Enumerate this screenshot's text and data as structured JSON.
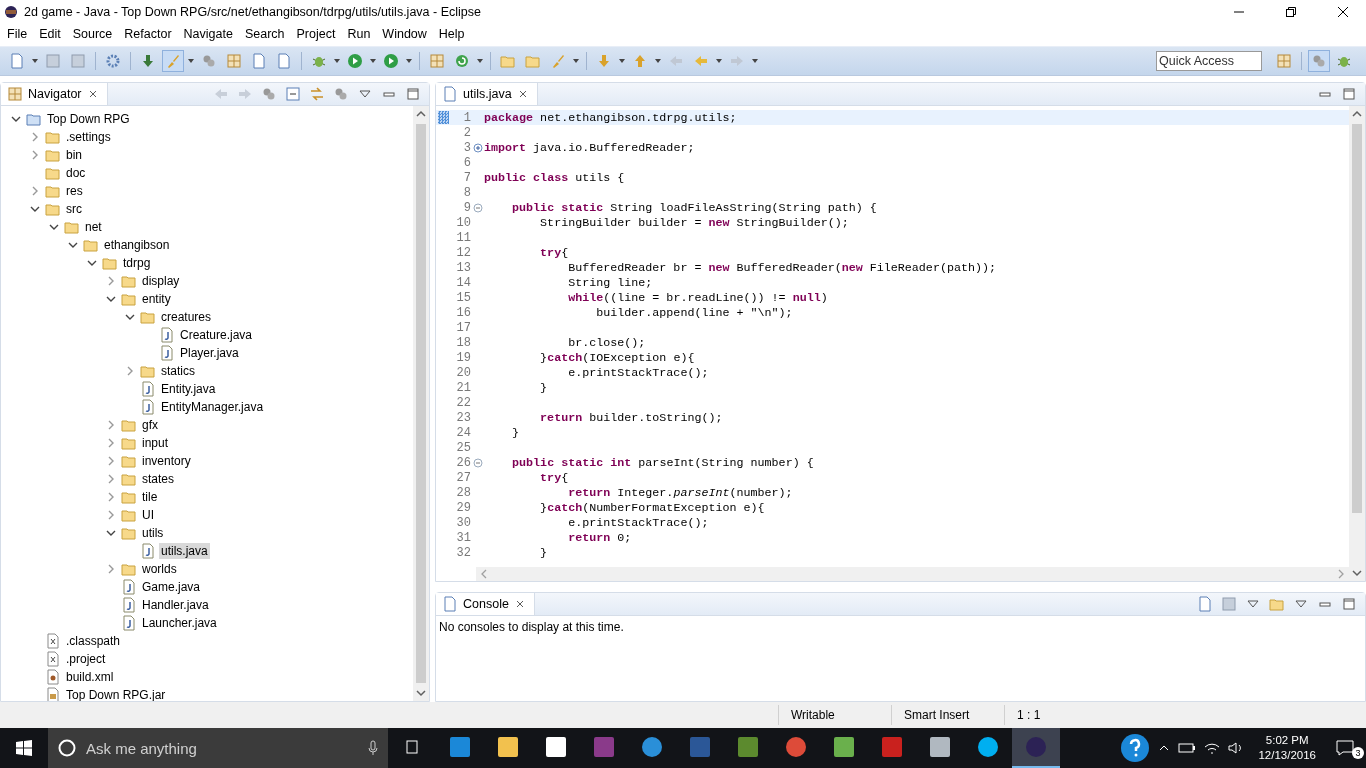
{
  "window": {
    "title": "2d game - Java - Top Down RPG/src/net/ethangibson/tdrpg/utils/utils.java - Eclipse"
  },
  "menu": [
    "File",
    "Edit",
    "Source",
    "Refactor",
    "Navigate",
    "Search",
    "Project",
    "Run",
    "Window",
    "Help"
  ],
  "quick_access": {
    "placeholder": "Quick Access"
  },
  "navigator": {
    "title": "Navigator",
    "tree": [
      {
        "label": "Top Down RPG",
        "kind": "project",
        "expanded": true,
        "selected": false,
        "children": [
          {
            "label": ".settings",
            "kind": "folder",
            "expanded": false,
            "selected": false
          },
          {
            "label": "bin",
            "kind": "folder",
            "expanded": false,
            "selected": false
          },
          {
            "label": "doc",
            "kind": "folder",
            "selected": false
          },
          {
            "label": "res",
            "kind": "folder",
            "expanded": false,
            "selected": false
          },
          {
            "label": "src",
            "kind": "folder",
            "expanded": true,
            "selected": false,
            "children": [
              {
                "label": "net",
                "kind": "folder",
                "expanded": true,
                "selected": false,
                "children": [
                  {
                    "label": "ethangibson",
                    "kind": "folder",
                    "expanded": true,
                    "selected": false,
                    "children": [
                      {
                        "label": "tdrpg",
                        "kind": "folder",
                        "expanded": true,
                        "selected": false,
                        "children": [
                          {
                            "label": "display",
                            "kind": "folder",
                            "expanded": false,
                            "selected": false
                          },
                          {
                            "label": "entity",
                            "kind": "folder",
                            "expanded": true,
                            "selected": false,
                            "children": [
                              {
                                "label": "creatures",
                                "kind": "folder",
                                "expanded": true,
                                "selected": false,
                                "children": [
                                  {
                                    "label": "Creature.java",
                                    "kind": "java",
                                    "selected": false
                                  },
                                  {
                                    "label": "Player.java",
                                    "kind": "java",
                                    "selected": false
                                  }
                                ]
                              },
                              {
                                "label": "statics",
                                "kind": "folder",
                                "expanded": false,
                                "selected": false
                              },
                              {
                                "label": "Entity.java",
                                "kind": "java",
                                "selected": false
                              },
                              {
                                "label": "EntityManager.java",
                                "kind": "java",
                                "selected": false
                              }
                            ]
                          },
                          {
                            "label": "gfx",
                            "kind": "folder",
                            "expanded": false,
                            "selected": false
                          },
                          {
                            "label": "input",
                            "kind": "folder",
                            "expanded": false,
                            "selected": false
                          },
                          {
                            "label": "inventory",
                            "kind": "folder",
                            "expanded": false,
                            "selected": false
                          },
                          {
                            "label": "states",
                            "kind": "folder",
                            "expanded": false,
                            "selected": false
                          },
                          {
                            "label": "tile",
                            "kind": "folder",
                            "expanded": false,
                            "selected": false
                          },
                          {
                            "label": "UI",
                            "kind": "folder",
                            "expanded": false,
                            "selected": false
                          },
                          {
                            "label": "utils",
                            "kind": "folder",
                            "expanded": true,
                            "selected": false,
                            "children": [
                              {
                                "label": "utils.java",
                                "kind": "java",
                                "selected": true
                              }
                            ]
                          },
                          {
                            "label": "worlds",
                            "kind": "folder",
                            "expanded": false,
                            "selected": false
                          },
                          {
                            "label": "Game.java",
                            "kind": "java",
                            "selected": false
                          },
                          {
                            "label": "Handler.java",
                            "kind": "java",
                            "selected": false
                          },
                          {
                            "label": "Launcher.java",
                            "kind": "java",
                            "selected": false
                          }
                        ]
                      }
                    ]
                  }
                ]
              }
            ]
          },
          {
            "label": ".classpath",
            "kind": "xml",
            "selected": false
          },
          {
            "label": ".project",
            "kind": "xml",
            "selected": false
          },
          {
            "label": "build.xml",
            "kind": "ant",
            "selected": false
          },
          {
            "label": "Top Down RPG.jar",
            "kind": "jar",
            "selected": false
          }
        ]
      }
    ]
  },
  "editor": {
    "tab": "utils.java",
    "lines": [
      {
        "number": "1",
        "text": "**package** net.ethangibson.tdrpg.utils;",
        "current": true
      },
      {
        "number": "2",
        "current": false
      },
      {
        "number": "3",
        "text": "**import** java.io.BufferedReader;",
        "folded": true,
        "current": false
      },
      {
        "number": "6",
        "current": false
      },
      {
        "number": "7",
        "text": "**public** **class** utils {",
        "current": false
      },
      {
        "number": "8",
        "current": false
      },
      {
        "number": "9",
        "text": "    **public** **static** String loadFileAsString(String path) {",
        "folded": false,
        "current": false
      },
      {
        "number": "10",
        "text": "        StringBuilder builder = **new** StringBuilder();",
        "current": false
      },
      {
        "number": "11",
        "current": false
      },
      {
        "number": "12",
        "text": "        **try**{",
        "current": false
      },
      {
        "number": "13",
        "text": "            BufferedReader br = **new** BufferedReader(**new** FileReader(path));",
        "current": false
      },
      {
        "number": "14",
        "text": "            String line;",
        "current": false
      },
      {
        "number": "15",
        "text": "            **while**((line = br.readLine()) != **null**)",
        "current": false
      },
      {
        "number": "16",
        "text": "                builder.append(line + \"\\n\");",
        "current": false
      },
      {
        "number": "17",
        "current": false
      },
      {
        "number": "18",
        "text": "            br.close();",
        "current": false
      },
      {
        "number": "19",
        "text": "        }**catch**(IOException e){",
        "current": false
      },
      {
        "number": "20",
        "text": "            e.printStackTrace();",
        "current": false
      },
      {
        "number": "21",
        "text": "        }",
        "current": false
      },
      {
        "number": "22",
        "current": false
      },
      {
        "number": "23",
        "text": "        **return** builder.toString();",
        "current": false
      },
      {
        "number": "24",
        "text": "    }",
        "current": false
      },
      {
        "number": "25",
        "current": false
      },
      {
        "number": "26",
        "text": "    **public** **static** **int** parseInt(String number) {",
        "folded": false,
        "current": false
      },
      {
        "number": "27",
        "text": "        **try**{",
        "current": false
      },
      {
        "number": "28",
        "text": "            **return** Integer.*parseInt*(number);",
        "current": false
      },
      {
        "number": "29",
        "text": "        }**catch**(NumberFormatException e){",
        "current": false
      },
      {
        "number": "30",
        "text": "            e.printStackTrace();",
        "current": false
      },
      {
        "number": "31",
        "text": "            **return** 0;",
        "current": false
      },
      {
        "number": "32",
        "text": "        }",
        "current": false
      }
    ]
  },
  "console": {
    "title": "Console",
    "message": "No consoles to display at this time."
  },
  "status_bar": [
    "Writable",
    "Smart Insert",
    "1 : 1"
  ],
  "taskbar": {
    "search": {
      "placeholder": "Ask me anything"
    },
    "time": "5:02 PM",
    "date": "12/13/2016",
    "notifications": "3"
  }
}
